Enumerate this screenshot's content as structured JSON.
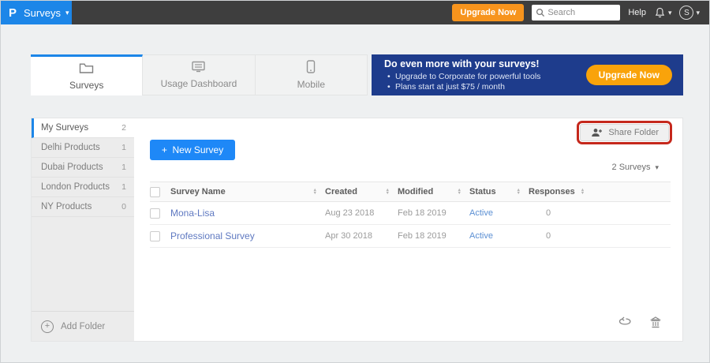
{
  "topbar": {
    "logo_letter": "P",
    "app_menu": "Surveys",
    "upgrade_button": "Upgrade Now",
    "search_placeholder": "Search",
    "help": "Help",
    "avatar_letter": "S"
  },
  "icons": {
    "caret": "▾",
    "plus": "+"
  },
  "tabs": [
    {
      "label": "Surveys"
    },
    {
      "label": "Usage Dashboard"
    },
    {
      "label": "Mobile"
    }
  ],
  "banner": {
    "title": "Do even more with your surveys!",
    "bullets": [
      "Upgrade to Corporate for powerful tools",
      "Plans start at just $75 / month"
    ],
    "cta": "Upgrade Now"
  },
  "sidebar": {
    "folders": [
      {
        "label": "My Surveys",
        "count": "2"
      },
      {
        "label": "Delhi Products",
        "count": "1"
      },
      {
        "label": "Dubai Products",
        "count": "1"
      },
      {
        "label": "London Products",
        "count": "1"
      },
      {
        "label": "NY Products",
        "count": "0"
      }
    ],
    "add_folder": "Add Folder"
  },
  "toolbar": {
    "new_survey": "New Survey",
    "share_folder": "Share Folder",
    "survey_count": "2 Surveys"
  },
  "table": {
    "headers": [
      "Survey Name",
      "Created",
      "Modified",
      "Status",
      "Responses"
    ],
    "rows": [
      {
        "name": "Mona-Lisa",
        "created": "Aug 23 2018",
        "modified": "Feb 18 2019",
        "status": "Active",
        "responses": "0"
      },
      {
        "name": "Professional Survey",
        "created": "Apr 30 2018",
        "modified": "Feb 18 2019",
        "status": "Active",
        "responses": "0"
      }
    ]
  },
  "colors": {
    "accent_blue": "#1c86e8",
    "banner_navy": "#1e3c8c",
    "orange": "#f7941d",
    "annotation_red": "#c5281c",
    "link_blue": "#5f79c1",
    "status_blue": "#5b8fd3"
  }
}
